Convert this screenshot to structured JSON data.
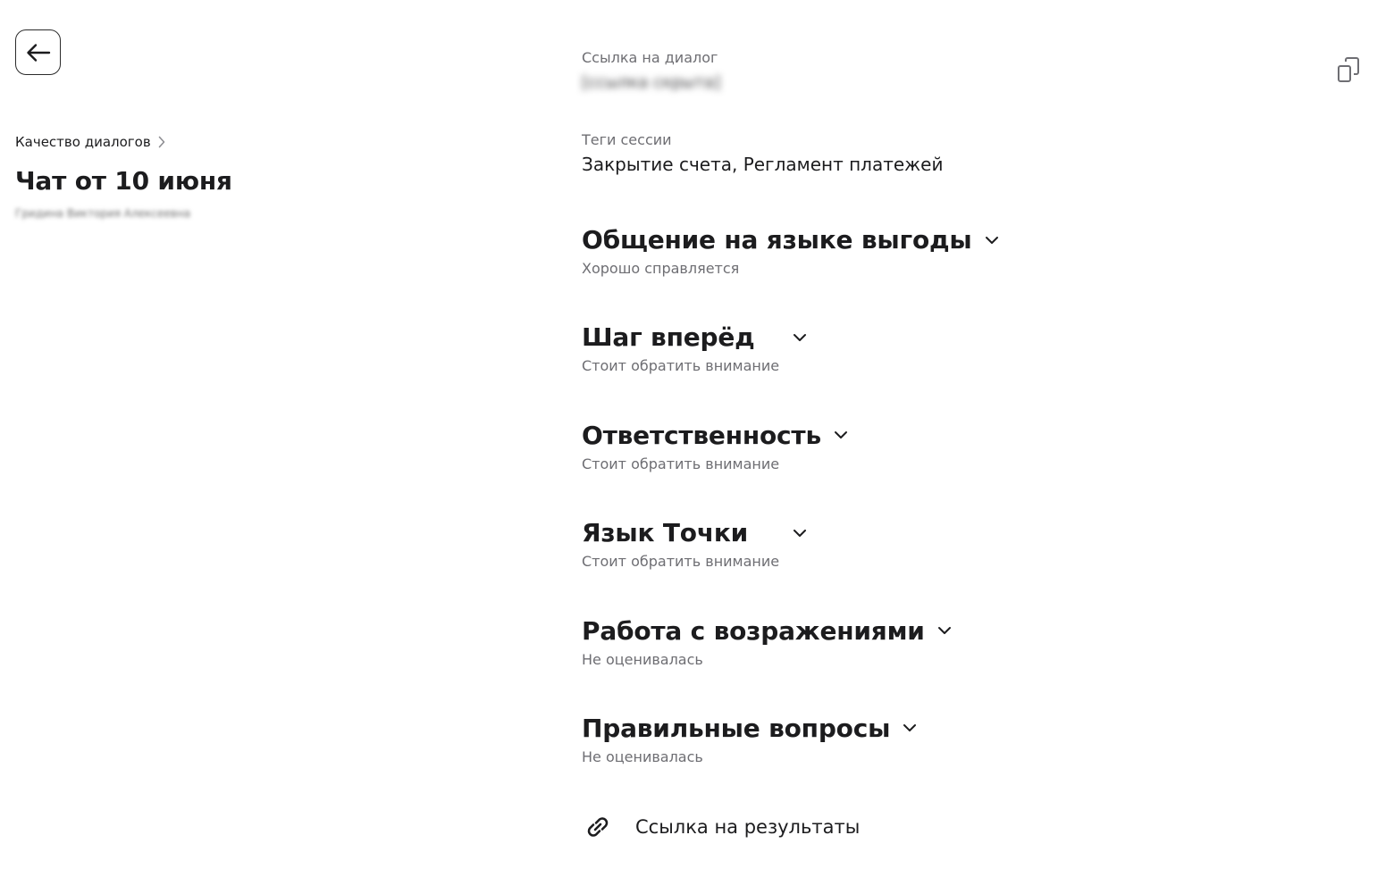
{
  "back_button": {
    "icon": "arrow-left-icon"
  },
  "breadcrumb": {
    "label": "Качество диалогов",
    "icon": "chevron-right-icon"
  },
  "page": {
    "title": "Чат от 10 июня",
    "author": "Гридина Виктория Алексеевна"
  },
  "dialog_link": {
    "label": "Ссылка на диалог",
    "value": "[ссылка скрыта]",
    "copy_icon": "copy-icon"
  },
  "session_tags": {
    "label": "Теги сессии",
    "value": "Закрытие счета, Регламент платежей"
  },
  "criteria": [
    {
      "title": "Общение на языке выгоды",
      "status": "Хорошо справляется"
    },
    {
      "title": "Шаг вперёд",
      "status": "Стоит обратить внимание"
    },
    {
      "title": "Ответственность",
      "status": "Стоит обратить внимание"
    },
    {
      "title": "Язык Точки",
      "status": "Стоит обратить внимание"
    },
    {
      "title": "Работа с возражениями",
      "status": "Не оценивалась"
    },
    {
      "title": "Правильные вопросы",
      "status": "Не оценивалась"
    }
  ],
  "results_link": {
    "label": "Ссылка на результаты",
    "icon": "link-icon"
  }
}
